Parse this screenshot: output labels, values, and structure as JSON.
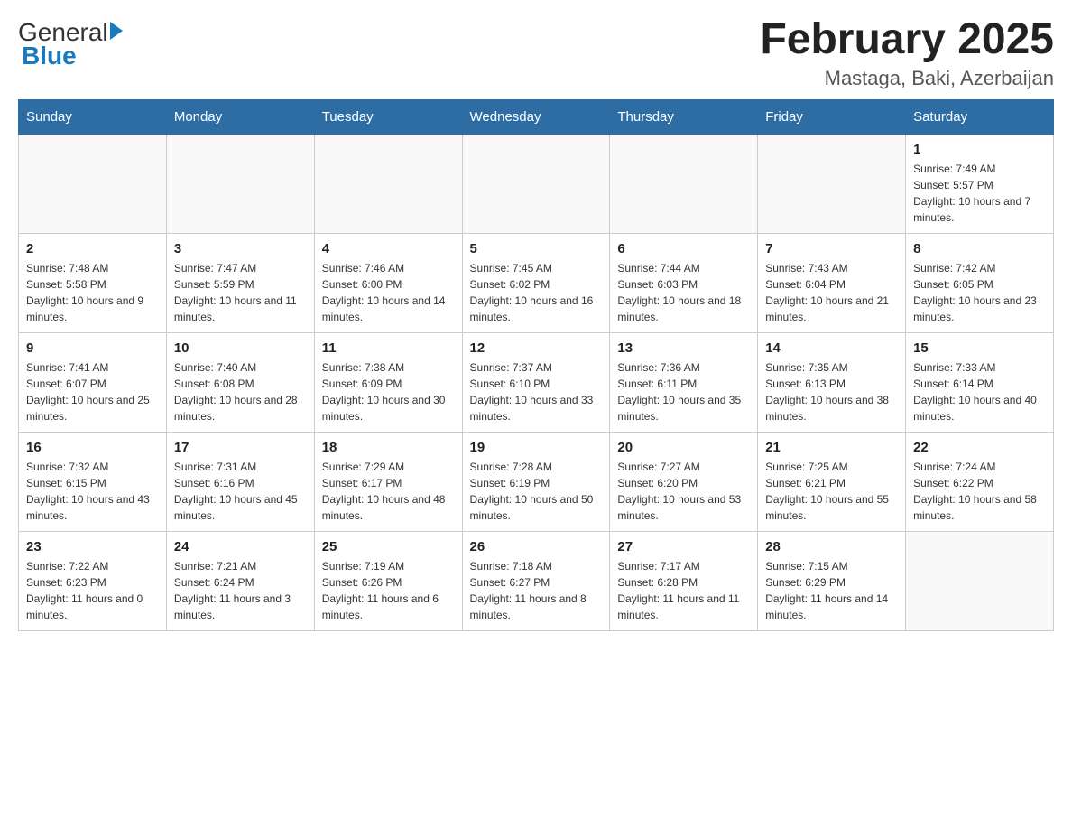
{
  "header": {
    "logo_general": "General",
    "logo_blue": "Blue",
    "month_year": "February 2025",
    "location": "Mastaga, Baki, Azerbaijan"
  },
  "days_of_week": [
    "Sunday",
    "Monday",
    "Tuesday",
    "Wednesday",
    "Thursday",
    "Friday",
    "Saturday"
  ],
  "weeks": [
    [
      {
        "day": "",
        "sunrise": "",
        "sunset": "",
        "daylight": ""
      },
      {
        "day": "",
        "sunrise": "",
        "sunset": "",
        "daylight": ""
      },
      {
        "day": "",
        "sunrise": "",
        "sunset": "",
        "daylight": ""
      },
      {
        "day": "",
        "sunrise": "",
        "sunset": "",
        "daylight": ""
      },
      {
        "day": "",
        "sunrise": "",
        "sunset": "",
        "daylight": ""
      },
      {
        "day": "",
        "sunrise": "",
        "sunset": "",
        "daylight": ""
      },
      {
        "day": "1",
        "sunrise": "Sunrise: 7:49 AM",
        "sunset": "Sunset: 5:57 PM",
        "daylight": "Daylight: 10 hours and 7 minutes."
      }
    ],
    [
      {
        "day": "2",
        "sunrise": "Sunrise: 7:48 AM",
        "sunset": "Sunset: 5:58 PM",
        "daylight": "Daylight: 10 hours and 9 minutes."
      },
      {
        "day": "3",
        "sunrise": "Sunrise: 7:47 AM",
        "sunset": "Sunset: 5:59 PM",
        "daylight": "Daylight: 10 hours and 11 minutes."
      },
      {
        "day": "4",
        "sunrise": "Sunrise: 7:46 AM",
        "sunset": "Sunset: 6:00 PM",
        "daylight": "Daylight: 10 hours and 14 minutes."
      },
      {
        "day": "5",
        "sunrise": "Sunrise: 7:45 AM",
        "sunset": "Sunset: 6:02 PM",
        "daylight": "Daylight: 10 hours and 16 minutes."
      },
      {
        "day": "6",
        "sunrise": "Sunrise: 7:44 AM",
        "sunset": "Sunset: 6:03 PM",
        "daylight": "Daylight: 10 hours and 18 minutes."
      },
      {
        "day": "7",
        "sunrise": "Sunrise: 7:43 AM",
        "sunset": "Sunset: 6:04 PM",
        "daylight": "Daylight: 10 hours and 21 minutes."
      },
      {
        "day": "8",
        "sunrise": "Sunrise: 7:42 AM",
        "sunset": "Sunset: 6:05 PM",
        "daylight": "Daylight: 10 hours and 23 minutes."
      }
    ],
    [
      {
        "day": "9",
        "sunrise": "Sunrise: 7:41 AM",
        "sunset": "Sunset: 6:07 PM",
        "daylight": "Daylight: 10 hours and 25 minutes."
      },
      {
        "day": "10",
        "sunrise": "Sunrise: 7:40 AM",
        "sunset": "Sunset: 6:08 PM",
        "daylight": "Daylight: 10 hours and 28 minutes."
      },
      {
        "day": "11",
        "sunrise": "Sunrise: 7:38 AM",
        "sunset": "Sunset: 6:09 PM",
        "daylight": "Daylight: 10 hours and 30 minutes."
      },
      {
        "day": "12",
        "sunrise": "Sunrise: 7:37 AM",
        "sunset": "Sunset: 6:10 PM",
        "daylight": "Daylight: 10 hours and 33 minutes."
      },
      {
        "day": "13",
        "sunrise": "Sunrise: 7:36 AM",
        "sunset": "Sunset: 6:11 PM",
        "daylight": "Daylight: 10 hours and 35 minutes."
      },
      {
        "day": "14",
        "sunrise": "Sunrise: 7:35 AM",
        "sunset": "Sunset: 6:13 PM",
        "daylight": "Daylight: 10 hours and 38 minutes."
      },
      {
        "day": "15",
        "sunrise": "Sunrise: 7:33 AM",
        "sunset": "Sunset: 6:14 PM",
        "daylight": "Daylight: 10 hours and 40 minutes."
      }
    ],
    [
      {
        "day": "16",
        "sunrise": "Sunrise: 7:32 AM",
        "sunset": "Sunset: 6:15 PM",
        "daylight": "Daylight: 10 hours and 43 minutes."
      },
      {
        "day": "17",
        "sunrise": "Sunrise: 7:31 AM",
        "sunset": "Sunset: 6:16 PM",
        "daylight": "Daylight: 10 hours and 45 minutes."
      },
      {
        "day": "18",
        "sunrise": "Sunrise: 7:29 AM",
        "sunset": "Sunset: 6:17 PM",
        "daylight": "Daylight: 10 hours and 48 minutes."
      },
      {
        "day": "19",
        "sunrise": "Sunrise: 7:28 AM",
        "sunset": "Sunset: 6:19 PM",
        "daylight": "Daylight: 10 hours and 50 minutes."
      },
      {
        "day": "20",
        "sunrise": "Sunrise: 7:27 AM",
        "sunset": "Sunset: 6:20 PM",
        "daylight": "Daylight: 10 hours and 53 minutes."
      },
      {
        "day": "21",
        "sunrise": "Sunrise: 7:25 AM",
        "sunset": "Sunset: 6:21 PM",
        "daylight": "Daylight: 10 hours and 55 minutes."
      },
      {
        "day": "22",
        "sunrise": "Sunrise: 7:24 AM",
        "sunset": "Sunset: 6:22 PM",
        "daylight": "Daylight: 10 hours and 58 minutes."
      }
    ],
    [
      {
        "day": "23",
        "sunrise": "Sunrise: 7:22 AM",
        "sunset": "Sunset: 6:23 PM",
        "daylight": "Daylight: 11 hours and 0 minutes."
      },
      {
        "day": "24",
        "sunrise": "Sunrise: 7:21 AM",
        "sunset": "Sunset: 6:24 PM",
        "daylight": "Daylight: 11 hours and 3 minutes."
      },
      {
        "day": "25",
        "sunrise": "Sunrise: 7:19 AM",
        "sunset": "Sunset: 6:26 PM",
        "daylight": "Daylight: 11 hours and 6 minutes."
      },
      {
        "day": "26",
        "sunrise": "Sunrise: 7:18 AM",
        "sunset": "Sunset: 6:27 PM",
        "daylight": "Daylight: 11 hours and 8 minutes."
      },
      {
        "day": "27",
        "sunrise": "Sunrise: 7:17 AM",
        "sunset": "Sunset: 6:28 PM",
        "daylight": "Daylight: 11 hours and 11 minutes."
      },
      {
        "day": "28",
        "sunrise": "Sunrise: 7:15 AM",
        "sunset": "Sunset: 6:29 PM",
        "daylight": "Daylight: 11 hours and 14 minutes."
      },
      {
        "day": "",
        "sunrise": "",
        "sunset": "",
        "daylight": ""
      }
    ]
  ]
}
